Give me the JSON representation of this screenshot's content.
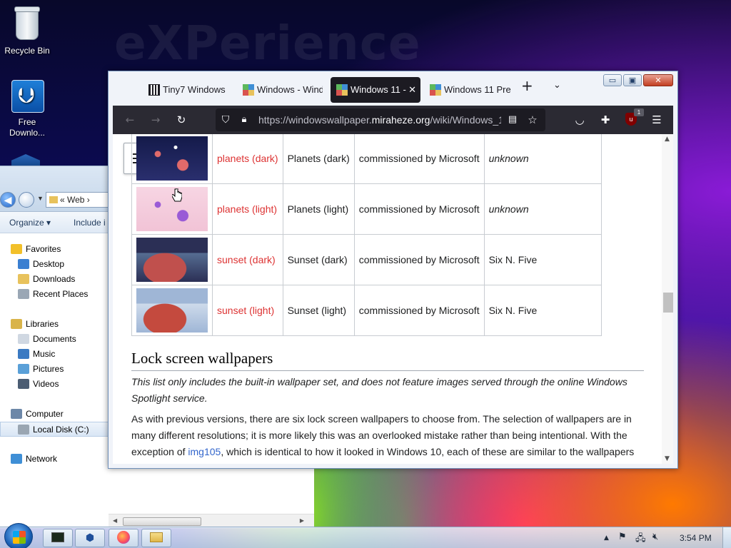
{
  "desktop": {
    "watermark": "eXPerience",
    "icons": [
      {
        "label": "Recycle Bin"
      },
      {
        "label": "Free Downlo..."
      }
    ]
  },
  "explorer": {
    "address_crumb": "« Web ›",
    "toolbar": {
      "organize": "Organize ▾",
      "include": "Include i"
    },
    "nav": [
      {
        "label": "Favorites",
        "icon": "star-icon",
        "color": "#f2c02a"
      },
      {
        "label": "Desktop",
        "icon": "desktop-icon",
        "color": "#3a7fd1"
      },
      {
        "label": "Downloads",
        "icon": "downloads-folder-icon",
        "color": "#e8c25c"
      },
      {
        "label": "Recent Places",
        "icon": "recent-places-icon",
        "color": "#9aa7b5"
      },
      {
        "label": "Libraries",
        "icon": "libraries-icon",
        "color": "#d9b44a"
      },
      {
        "label": "Documents",
        "icon": "documents-icon",
        "color": "#d0d8e2"
      },
      {
        "label": "Music",
        "icon": "music-icon",
        "color": "#3b7ac2"
      },
      {
        "label": "Pictures",
        "icon": "pictures-icon",
        "color": "#5aa0d8"
      },
      {
        "label": "Videos",
        "icon": "videos-icon",
        "color": "#4b5d73"
      },
      {
        "label": "Computer",
        "icon": "computer-icon",
        "color": "#6c87a8"
      },
      {
        "label": "Local Disk (C:)",
        "icon": "drive-icon",
        "color": "#9aa6b2"
      },
      {
        "label": "Network",
        "icon": "network-icon",
        "color": "#3f8fd6"
      }
    ]
  },
  "browser": {
    "tabs": [
      {
        "label": "Tiny7 Windows",
        "active": false
      },
      {
        "label": "Windows - Wind",
        "active": false
      },
      {
        "label": "Windows 11 -",
        "active": true
      },
      {
        "label": "Windows 11 Pre",
        "active": false
      }
    ],
    "new_tab": "+",
    "tab_list": "⌄",
    "close_tab": "✕",
    "url_prefix": "https://windowswallpaper.",
    "url_domain": "miraheze.org",
    "url_suffix": "/wiki/Windows_1",
    "badge_count": "1",
    "window_buttons": {
      "minimize": "▭",
      "maximize": "▣",
      "close": "✕"
    }
  },
  "page": {
    "wallpapers": [
      {
        "link": "planets (dark)",
        "name": "Planets (dark)",
        "source": "commissioned by Microsoft",
        "author": "unknown",
        "author_italic": true,
        "palette": [
          "#141a4a",
          "#2a2f6e",
          "#e06a6a"
        ]
      },
      {
        "link": "planets (light)",
        "name": "Planets (light)",
        "source": "commissioned by Microsoft",
        "author": "unknown",
        "author_italic": true,
        "palette": [
          "#f7d5e3",
          "#f1c3d6",
          "#9a5bd6"
        ]
      },
      {
        "link": "sunset (dark)",
        "name": "Sunset (dark)",
        "source": "commissioned by Microsoft",
        "author": "Six N. Five",
        "author_italic": false,
        "palette": [
          "#2b2f55",
          "#c0504d",
          "#6d8fb3"
        ]
      },
      {
        "link": "sunset (light)",
        "name": "Sunset (light)",
        "source": "commissioned by Microsoft",
        "author": "Six N. Five",
        "author_italic": false,
        "palette": [
          "#9fb6d6",
          "#c44a3e",
          "#e7eef6"
        ]
      }
    ],
    "section_heading": "Lock screen wallpapers",
    "note": "This list only includes the built-in wallpaper set, and does not feature images served through the online Windows Spotlight service.",
    "body_before_link": "As with previous versions, there are six lock screen wallpapers to choose from. The selection of wallpapers are in many different resolutions; it is more likely this was an overlooked mistake rather than being intentional. With the exception of ",
    "body_link": "img105",
    "body_after_link": ", which is identical to how it looked in Windows 10, each of these are similar to the wallpapers"
  },
  "taskbar": {
    "clock": "3:54 PM",
    "tray_up": "▲"
  }
}
